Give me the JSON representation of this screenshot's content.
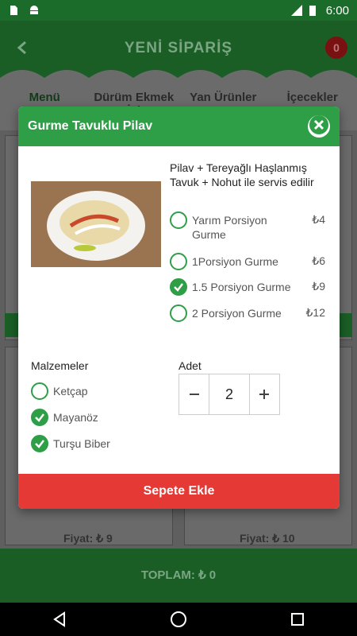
{
  "status_bar": {
    "time": "6:00",
    "network": "LTE"
  },
  "app_bar": {
    "title": "YENİ SİPARİŞ",
    "cart_count": "0"
  },
  "tabs": [
    {
      "label": "Menü"
    },
    {
      "label": "Dürüm Ekmek İçi"
    },
    {
      "label": "Yan Ürünler"
    },
    {
      "label": "İçecekler"
    }
  ],
  "background": {
    "price_left": "Fiyat: ₺ 9",
    "price_right": "Fiyat: ₺ 10",
    "total": "TOPLAM: ₺ 0"
  },
  "dialog": {
    "title": "Gurme Tavuklu Pilav",
    "description": "Pilav + Tereyağlı Haşlanmış Tavuk + Nohut ile servis edilir",
    "options": [
      {
        "label": "Yarım Porsiyon Gurme",
        "price": "₺4",
        "checked": false
      },
      {
        "label": "1Porsiyon Gurme",
        "price": "₺6",
        "checked": false
      },
      {
        "label": "1.5 Porsiyon Gurme",
        "price": "₺9",
        "checked": true
      },
      {
        "label": "2 Porsiyon Gurme",
        "price": "₺12",
        "checked": false
      }
    ],
    "ingredients_label": "Malzemeler",
    "ingredients": [
      {
        "label": "Ketçap",
        "checked": false
      },
      {
        "label": "Mayanöz",
        "checked": true
      },
      {
        "label": "Turşu Biber",
        "checked": true
      }
    ],
    "quantity_label": "Adet",
    "quantity": "2",
    "add_button": "Sepete Ekle"
  },
  "colors": {
    "primary_green": "#2e9e47",
    "add_red": "#e53935"
  }
}
